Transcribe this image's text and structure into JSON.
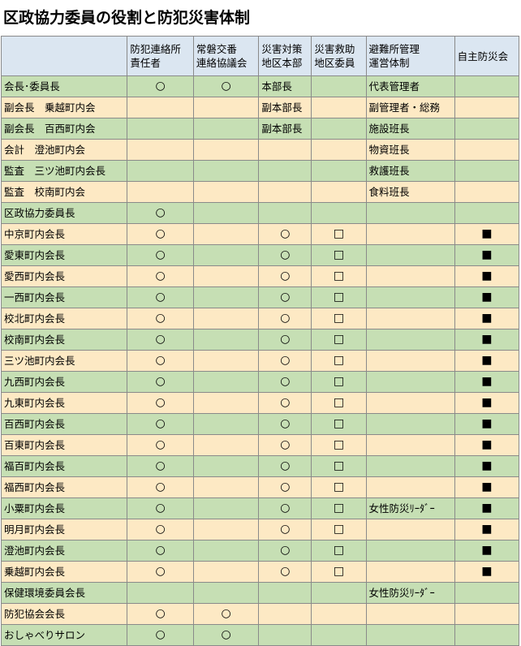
{
  "title": "区政協力委員の役割と防犯災害体制",
  "headers": [
    "",
    "防犯連絡所\n責任者",
    "常磐交番\n連絡協議会",
    "災害対策\n地区本部",
    "災害救助\n地区委員",
    "避難所管理\n運営体制",
    "自主防災会"
  ],
  "rows": [
    {
      "name": "会長･委員長",
      "c1": "○",
      "c2": "○",
      "c3": "本部長",
      "c4": "",
      "c5": "代表管理者",
      "c6": ""
    },
    {
      "name": "副会長　乗越町内会",
      "c1": "",
      "c2": "",
      "c3": "副本部長",
      "c4": "",
      "c5": "副管理者・総務",
      "c6": ""
    },
    {
      "name": "副会長　百西町内会",
      "c1": "",
      "c2": "",
      "c3": "副本部長",
      "c4": "",
      "c5": "施設班長",
      "c6": ""
    },
    {
      "name": "会計　澄池町内会",
      "c1": "",
      "c2": "",
      "c3": "",
      "c4": "",
      "c5": "物資班長",
      "c6": ""
    },
    {
      "name": "監査　三ツ池町内会長",
      "c1": "",
      "c2": "",
      "c3": "",
      "c4": "",
      "c5": "救護班長",
      "c6": ""
    },
    {
      "name": "監査　校南町内会",
      "c1": "",
      "c2": "",
      "c3": "",
      "c4": "",
      "c5": "食料班長",
      "c6": ""
    },
    {
      "name": "区政協力委員長",
      "c1": "○",
      "c2": "",
      "c3": "",
      "c4": "",
      "c5": "",
      "c6": ""
    },
    {
      "name": "中京町内会長",
      "c1": "○",
      "c2": "",
      "c3": "○",
      "c4": "□",
      "c5": "",
      "c6": "■"
    },
    {
      "name": "愛東町内会長",
      "c1": "○",
      "c2": "",
      "c3": "○",
      "c4": "□",
      "c5": "",
      "c6": "■"
    },
    {
      "name": "愛西町内会長",
      "c1": "○",
      "c2": "",
      "c3": "○",
      "c4": "□",
      "c5": "",
      "c6": "■"
    },
    {
      "name": "一西町内会長",
      "c1": "○",
      "c2": "",
      "c3": "○",
      "c4": "□",
      "c5": "",
      "c6": "■"
    },
    {
      "name": "校北町内会長",
      "c1": "○",
      "c2": "",
      "c3": "○",
      "c4": "□",
      "c5": "",
      "c6": "■"
    },
    {
      "name": "校南町内会長",
      "c1": "○",
      "c2": "",
      "c3": "○",
      "c4": "□",
      "c5": "",
      "c6": "■"
    },
    {
      "name": "三ツ池町内会長",
      "c1": "○",
      "c2": "",
      "c3": "○",
      "c4": "□",
      "c5": "",
      "c6": "■"
    },
    {
      "name": "九西町内会長",
      "c1": "○",
      "c2": "",
      "c3": "○",
      "c4": "□",
      "c5": "",
      "c6": "■"
    },
    {
      "name": "九東町内会長",
      "c1": "○",
      "c2": "",
      "c3": "○",
      "c4": "□",
      "c5": "",
      "c6": "■"
    },
    {
      "name": "百西町内会長",
      "c1": "○",
      "c2": "",
      "c3": "○",
      "c4": "□",
      "c5": "",
      "c6": "■"
    },
    {
      "name": "百東町内会長",
      "c1": "○",
      "c2": "",
      "c3": "○",
      "c4": "□",
      "c5": "",
      "c6": "■"
    },
    {
      "name": "福百町内会長",
      "c1": "○",
      "c2": "",
      "c3": "○",
      "c4": "□",
      "c5": "",
      "c6": "■"
    },
    {
      "name": "福西町内会長",
      "c1": "○",
      "c2": "",
      "c3": "○",
      "c4": "□",
      "c5": "",
      "c6": "■"
    },
    {
      "name": "小粟町内会長",
      "c1": "○",
      "c2": "",
      "c3": "○",
      "c4": "□",
      "c5": "女性防災ﾘｰﾀﾞｰ",
      "c6": "■"
    },
    {
      "name": "明月町内会長",
      "c1": "○",
      "c2": "",
      "c3": "○",
      "c4": "□",
      "c5": "",
      "c6": "■"
    },
    {
      "name": "澄池町内会長",
      "c1": "○",
      "c2": "",
      "c3": "○",
      "c4": "□",
      "c5": "",
      "c6": "■"
    },
    {
      "name": "乗越町内会長",
      "c1": "○",
      "c2": "",
      "c3": "○",
      "c4": "□",
      "c5": "",
      "c6": "■"
    },
    {
      "name": "保健環境委員会長",
      "c1": "",
      "c2": "",
      "c3": "",
      "c4": "",
      "c5": "女性防災ﾘｰﾀﾞｰ",
      "c6": ""
    },
    {
      "name": "防犯協会会長",
      "c1": "○",
      "c2": "○",
      "c3": "",
      "c4": "",
      "c5": "",
      "c6": ""
    },
    {
      "name": "おしゃべりサロン",
      "c1": "○",
      "c2": "○",
      "c3": "",
      "c4": "",
      "c5": "",
      "c6": ""
    }
  ],
  "colors": {
    "header_bg": "#dbe6f1",
    "row_green": "#c6dfb4",
    "row_peach": "#fde9c4",
    "border": "#8a8a8a"
  }
}
